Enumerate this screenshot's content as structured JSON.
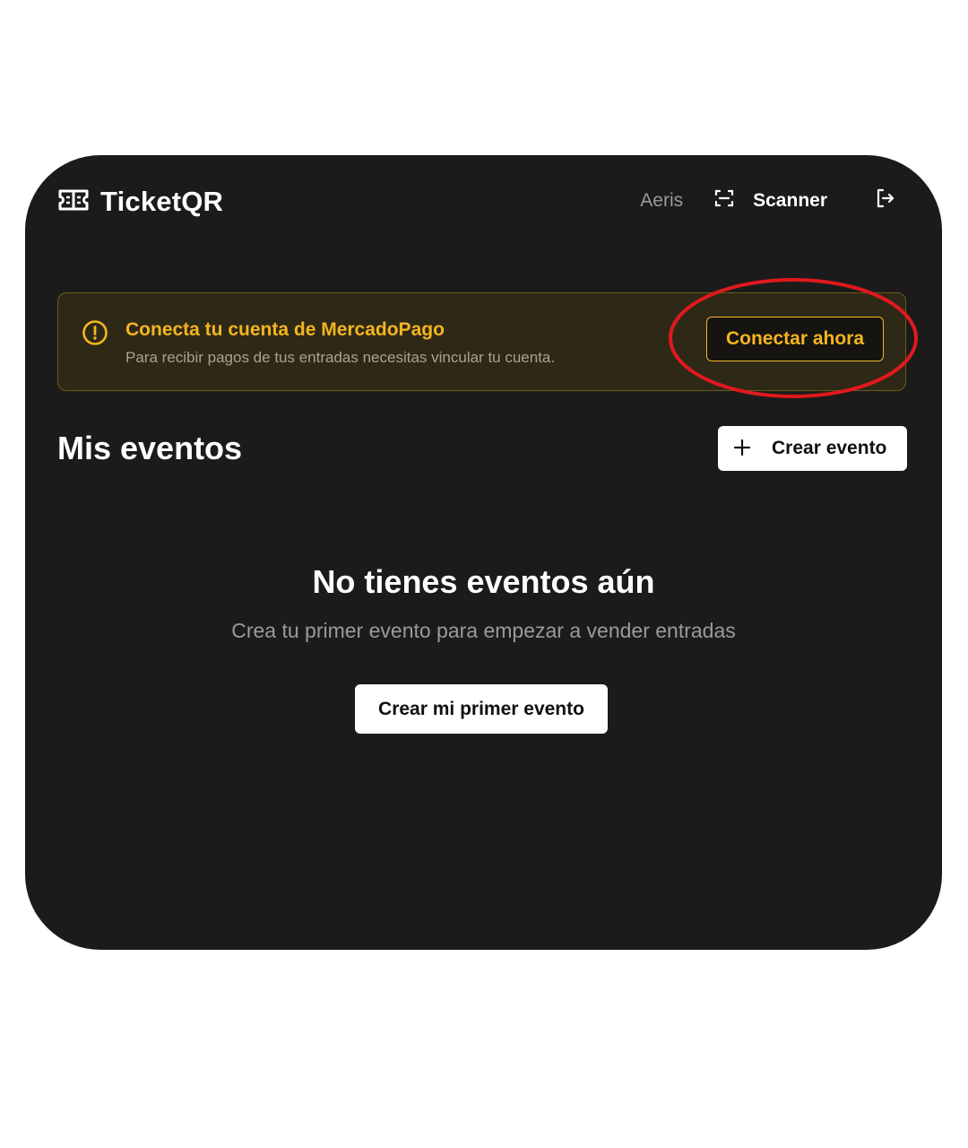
{
  "header": {
    "brand_name": "TicketQR",
    "user_name": "Aeris",
    "scanner_label": "Scanner",
    "brand_icon": "ticket-icon",
    "scanner_icon": "scan-icon",
    "logout_icon": "logout-icon"
  },
  "alert": {
    "title": "Conecta tu cuenta de MercadoPago",
    "description": "Para recibir pagos de tus entradas necesitas vincular tu cuenta.",
    "button_label": "Conectar ahora",
    "icon": "warning-icon"
  },
  "events": {
    "section_title": "Mis eventos",
    "create_button_label": "Crear evento",
    "create_icon": "plus-icon",
    "empty_title": "No tienes eventos aún",
    "empty_description": "Crea tu primer evento para empezar a vender entradas",
    "first_event_button_label": "Crear mi primer evento"
  },
  "colors": {
    "background": "#1b1b1b",
    "accent": "#f4b51f",
    "alert_background": "#2e2817",
    "annotation": "#e0191e"
  }
}
